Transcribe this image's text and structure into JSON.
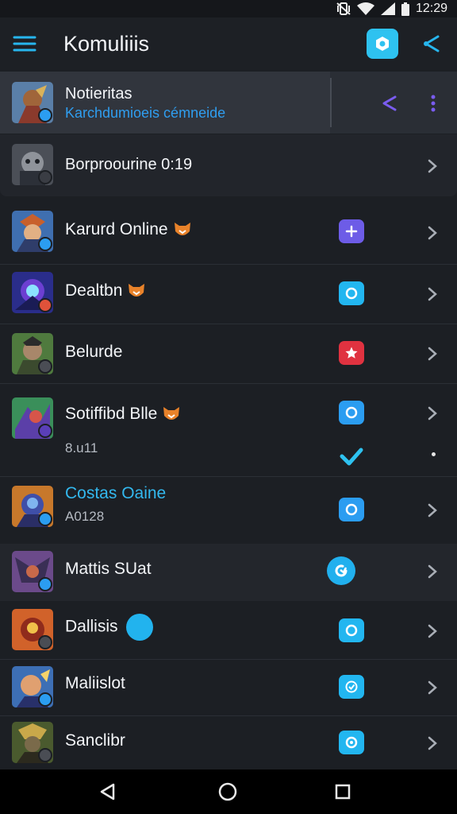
{
  "status_bar": {
    "time": "12:29",
    "icons": [
      "vibrate-icon",
      "wifi-icon",
      "cell-signal-icon",
      "battery-icon"
    ]
  },
  "app_bar": {
    "title": "Komuliiis",
    "icons": [
      "menu-icon",
      "app-action-icon",
      "share-icon"
    ]
  },
  "pinned": {
    "title": "Notieritas",
    "subtitle": "Karchdumioeis cémneide",
    "icons": [
      "share-icon",
      "more-vertical-icon"
    ]
  },
  "items": [
    {
      "title": "Borproourine 0:19",
      "subtitle": "",
      "status_icon": ""
    },
    {
      "title": "Karurd Online",
      "subtitle": "",
      "status_icon": "plus-icon"
    },
    {
      "title": "Dealtbn",
      "subtitle": "",
      "status_icon": "circle-icon"
    },
    {
      "title": "Belurde",
      "subtitle": "",
      "status_icon": "star-icon"
    },
    {
      "title": "Sotiffibd Blle",
      "subtitle": "8.u11",
      "status_icon": "circle-icon",
      "extra_icon": "check-icon"
    },
    {
      "title": "Costas Oaine",
      "subtitle": "A0128",
      "status_icon": "circle-icon"
    },
    {
      "title": "Mattis SUat",
      "subtitle": "",
      "status_icon": "refresh-icon"
    },
    {
      "title": "Dallisis",
      "subtitle": "",
      "status_icon": "circle-icon"
    },
    {
      "title": "Maliislot",
      "subtitle": "",
      "status_icon": "check-icon"
    },
    {
      "title": "Sanclibr",
      "subtitle": "",
      "status_icon": "circle-icon"
    }
  ],
  "nav_bar": {
    "icons": [
      "back-icon",
      "home-icon",
      "recents-icon"
    ]
  },
  "colors": {
    "background": "#1c1f24",
    "accent_cyan": "#22b6f0",
    "accent_purple": "#6d5ce7",
    "accent_red": "#e03240",
    "badge_orange": "#e8822a"
  }
}
